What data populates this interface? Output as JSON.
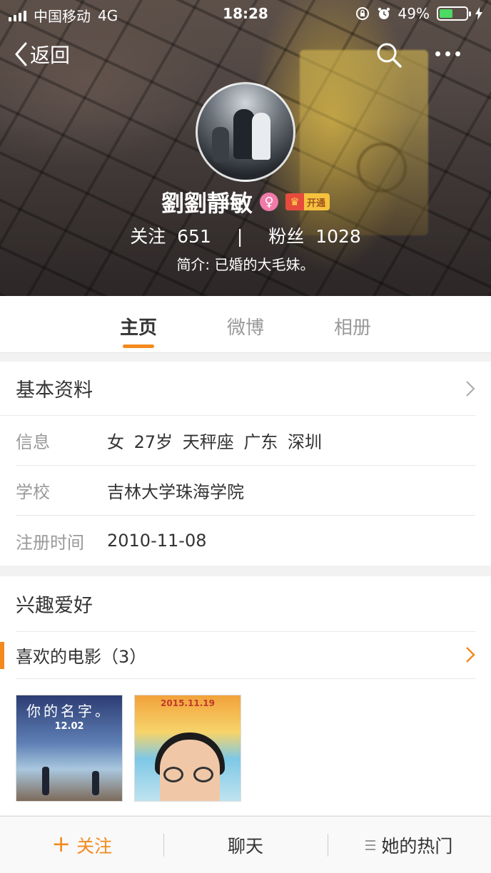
{
  "status_bar": {
    "carrier": "中国移动",
    "network": "4G",
    "time": "18:28",
    "battery": "49%",
    "battery_level": 0.49,
    "battery_color": "#4cd964"
  },
  "nav": {
    "back_label": "返回",
    "search_icon": "search-icon",
    "more_icon": "more-icon"
  },
  "profile": {
    "name": "劉劉靜敏",
    "vip_label": "开通",
    "following_label": "关注",
    "following_count": "651",
    "separator": "|",
    "followers_label": "粉丝",
    "followers_count": "1028",
    "intro": "简介: 已婚的大毛妹。"
  },
  "tabs": [
    {
      "label": "主页",
      "active": true
    },
    {
      "label": "微博",
      "active": false
    },
    {
      "label": "相册",
      "active": false
    }
  ],
  "basic_info": {
    "title": "基本资料",
    "rows": [
      {
        "label": "信息",
        "value": "女  27岁  天秤座  广东 深圳"
      },
      {
        "label": "学校",
        "value": "吉林大学珠海学院"
      },
      {
        "label": "注册时间",
        "value": "2010-11-08"
      }
    ]
  },
  "interests": {
    "title": "兴趣爱好",
    "movies_label": "喜欢的电影（3）",
    "posters": [
      {
        "title": "你的名字。",
        "date": "12.02"
      },
      {
        "date": "2015.11.19"
      }
    ]
  },
  "bottom_bar": {
    "follow_label": "关注",
    "chat_label": "聊天",
    "hot_label": "她的热门"
  },
  "colors": {
    "accent": "#f38a1e",
    "gender_badge": "#f07aa8",
    "vip_gold": "#f6c23e"
  }
}
